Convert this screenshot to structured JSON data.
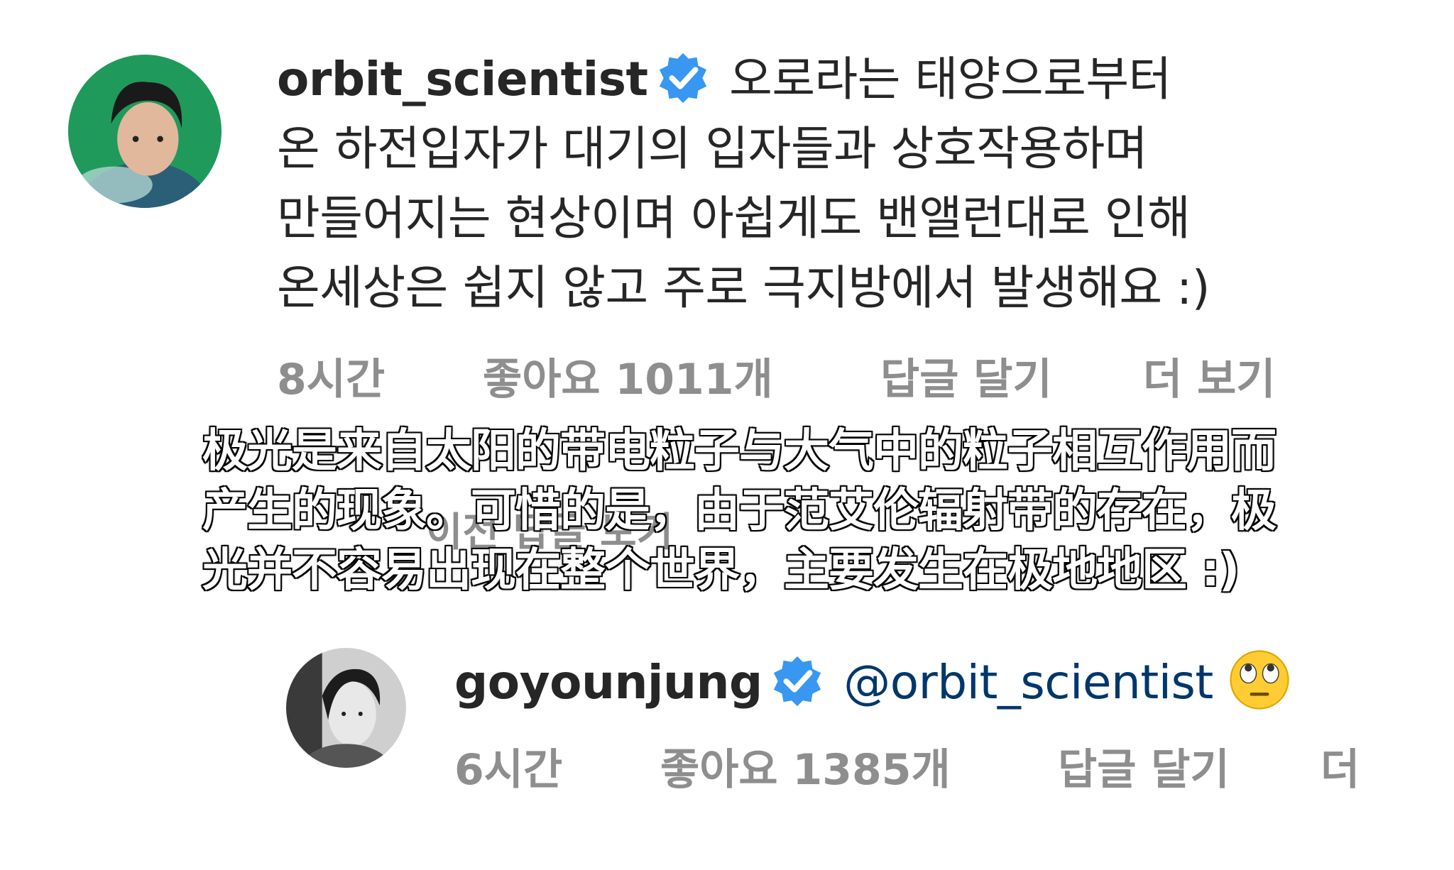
{
  "comment_1": {
    "username": "orbit_scientist",
    "text_lines": [
      "오로라는 태양으로부터",
      "온 하전입자가 대기의 입자들과 상호작용하며",
      "만들어지는 현상이며 아쉽게도 밴앨런대로 인해",
      "온세상은 쉽지 않고 주로 극지방에서 발생해요 :)"
    ],
    "time": "8시간",
    "likes": "좋아요 1011개",
    "reply": "답글 달기",
    "more": "더 보기",
    "view_replies": "이전 답글 보기"
  },
  "subtitle": {
    "lines": [
      "极光是来自太阳的带电粒子与大气中的粒子相互作用而",
      "产生的现象。可惜的是，由于范艾伦辐射带的存在，极",
      "光并不容易出现在整个世界，主要发生在极地地区 :)"
    ]
  },
  "comment_2": {
    "username": "goyounjung",
    "mention": "@orbit_scientist",
    "emoji": "face-with-rolling-eyes-emoji",
    "time": "6시간",
    "likes": "좋아요 1385개",
    "reply": "답글 달기",
    "more": "더"
  },
  "colors": {
    "verified_badge": "#3897f0",
    "meta_text": "#8e8e8e",
    "mention": "#00376b",
    "avatar_1_bg": "#1f9a5b"
  }
}
